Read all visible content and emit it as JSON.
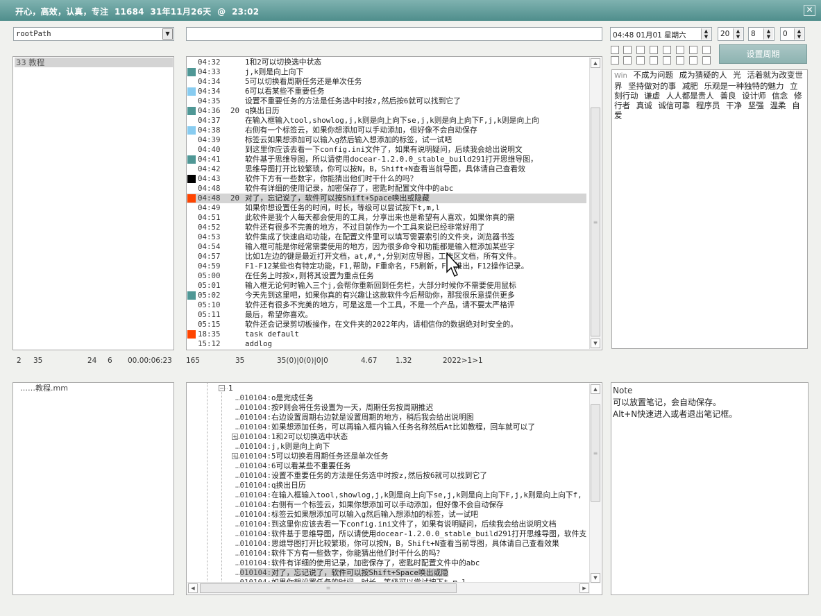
{
  "titlebar": {
    "title": "开心，高效，认真，专注  11684  31年11月26天  @  23:02",
    "close": "✕"
  },
  "top_controls": {
    "root_combo": "rootPath",
    "main_input": "",
    "datetime": "04:48 01月01 星期六",
    "spin1": "20",
    "spin2": "8",
    "spin3": "0",
    "period_button": "设置周期"
  },
  "left_list": {
    "items": [
      "33 教程"
    ]
  },
  "tasks": [
    {
      "time": "04:32",
      "pri": "",
      "color": "",
      "text": "1和2可以切换选中状态"
    },
    {
      "time": "04:33",
      "pri": "",
      "color": "#4f9795",
      "text": "j,k则是向上向下"
    },
    {
      "time": "04:34",
      "pri": "",
      "color": "",
      "text": "5可以切换看周期任务还是单次任务"
    },
    {
      "time": "04:34",
      "pri": "",
      "color": "#88ccf0",
      "text": "6可以看某些不重要任务"
    },
    {
      "time": "04:35",
      "pri": "",
      "color": "",
      "text": "设置不重要任务的方法是任务选中时按z,然后按6就可以找到它了"
    },
    {
      "time": "04:36",
      "pri": "20",
      "color": "#4f9795",
      "text": "q换出日历"
    },
    {
      "time": "04:37",
      "pri": "",
      "color": "",
      "text": "在输入框输入tool,showlog,j,k则是向上向下se,j,k则是向上向下F,j,k则是向上向"
    },
    {
      "time": "04:38",
      "pri": "",
      "color": "#88ccf0",
      "text": "右侧有一个标签云，如果你想添加可以手动添加，但好像不会自动保存"
    },
    {
      "time": "04:39",
      "pri": "",
      "color": "",
      "text": "标签云如果想添加可以输入g然后输入想添加的标签，试一试吧"
    },
    {
      "time": "04:40",
      "pri": "",
      "color": "",
      "text": "到这里你应该去看一下config.ini文件了，如果有说明疑问，后续我会给出说明文"
    },
    {
      "time": "04:41",
      "pri": "",
      "color": "#4f9795",
      "text": "软件基于思维导图，所以请使用docear-1.2.0.0_stable_build291打开思维导图，"
    },
    {
      "time": "04:42",
      "pri": "",
      "color": "",
      "text": "思维导图打开比较繁琐，你可以按N，B，Shift+N查看当前导图，具体请自己查看效"
    },
    {
      "time": "04:43",
      "pri": "",
      "color": "#000000",
      "text": "软件下方有一些数字，你能猜出他们时干什么的吗？"
    },
    {
      "time": "04:48",
      "pri": "",
      "color": "",
      "text": "软件有详细的使用记录，加密保存了，密匙时配置文件中的abc"
    },
    {
      "time": "04:48",
      "pri": "20",
      "color": "#ff4400",
      "text": "对了，忘记说了，软件可以按Shift+Space唤出或隐藏",
      "selected": true
    },
    {
      "time": "04:49",
      "pri": "",
      "color": "",
      "text": "如果你想设置任务的时间，时长，等级可以尝试按下t,m,l"
    },
    {
      "time": "04:51",
      "pri": "",
      "color": "",
      "text": "此软件是我个人每天都会使用的工具，分享出来也是希望有人喜欢，如果你真的需"
    },
    {
      "time": "04:52",
      "pri": "",
      "color": "",
      "text": "软件还有很多不完善的地方，不过目前作为一个工具来说已经非常好用了"
    },
    {
      "time": "04:53",
      "pri": "",
      "color": "",
      "text": "软件集成了快速启动功能，在配置文件里可以填写需要索引的文件夹，浏览器书签"
    },
    {
      "time": "04:54",
      "pri": "",
      "color": "",
      "text": "输入框可能是你经常需要使用的地方，因为很多命令和功能都是输入框添加某些字"
    },
    {
      "time": "04:57",
      "pri": "",
      "color": "",
      "text": "比如1左边的键是最近打开文档，at,#,*,分别对应导图，工作区文档，所有文件。"
    },
    {
      "time": "04:59",
      "pri": "",
      "color": "",
      "text": "F1-F12某些也有特定功能，F1,帮助，F重命名，F5刷新，F11推出，F12操作记录。"
    },
    {
      "time": "05:00",
      "pri": "",
      "color": "",
      "text": "在任务上时按x,则将其设置为重点任务"
    },
    {
      "time": "05:01",
      "pri": "",
      "color": "",
      "text": "输入框无论何时输入三个j,会帮你重新回到任务栏，大部分时候你不需要使用鼠标"
    },
    {
      "time": "05:02",
      "pri": "",
      "color": "#4f9795",
      "text": "今天先到这里吧，如果你真的有兴趣让这款软件今后帮助你，那我很乐意提供更多"
    },
    {
      "time": "05:10",
      "pri": "",
      "color": "",
      "text": "软件还有很多不完美的地方，可是这是一个工具，不是一个产品，请不要太严格评"
    },
    {
      "time": "05:11",
      "pri": "",
      "color": "",
      "text": "最后，希望你喜欢。"
    },
    {
      "time": "05:15",
      "pri": "",
      "color": "",
      "text": "软件还会记录剪切板操作，在文件夹的2022年内，请相信你的数据绝对时安全的。"
    },
    {
      "time": "18:35",
      "pri": "",
      "color": "#ff4400",
      "text": "task default"
    },
    {
      "time": "15:12",
      "pri": "",
      "color": "",
      "text": "addlog"
    }
  ],
  "status_bar": [
    "2",
    "35",
    "24",
    "6",
    "00.00:06:23",
    "165",
    "35",
    "35(0)|0(0)|0|0",
    "4.67",
    "1.32",
    "2022>1>1"
  ],
  "tag_cloud": [
    "Win",
    "不成为问题",
    "成为猜疑的人",
    "光",
    "活着就为改变世界",
    "坚持做对的事",
    "减肥",
    "乐观是一种独特的魅力",
    "立刻行动",
    "谦虚",
    "人人都是贵人",
    "善良",
    "设计师",
    "信念",
    "修行者",
    "真诚",
    "诚信可靠",
    "程序员",
    "干净",
    "坚强",
    "温柔",
    "自爱"
  ],
  "mindmap_list": {
    "items": [
      "……教程.mm"
    ]
  },
  "tree": {
    "root_label": "1",
    "prefix": "010104:",
    "rows": [
      {
        "text": "o是完成任务",
        "exp": false
      },
      {
        "text": "按P则会将任务设置为一天，周期任务按周期推迟",
        "exp": false
      },
      {
        "text": "右边设置周期右边就是设置周期的地方，稍后我会给出说明图",
        "exp": false
      },
      {
        "text": "如果想添加任务，可以再输入框内输入任务名称然后At比如教程，回车就可以了",
        "exp": false
      },
      {
        "text": "1和2可以切换选中状态",
        "exp": true
      },
      {
        "text": "j,k则是向上向下",
        "exp": false
      },
      {
        "text": "5可以切换看周期任务还是单次任务",
        "exp": true
      },
      {
        "text": "6可以看某些不重要任务",
        "exp": false
      },
      {
        "text": "设置不重要任务的方法是任务选中时按z,然后按6就可以找到它了",
        "exp": false
      },
      {
        "text": "q换出日历",
        "exp": false
      },
      {
        "text": "在输入框输入tool,showlog,j,k则是向上向下se,j,k则是向上向下F,j,k则是向上向下f,",
        "exp": false
      },
      {
        "text": "右侧有一个标签云，如果你想添加可以手动添加，但好像不会自动保存",
        "exp": false
      },
      {
        "text": "标签云如果想添加可以输入g然后输入想添加的标签，试一试吧",
        "exp": false
      },
      {
        "text": "到这里你应该去看一下config.ini文件了，如果有说明疑问，后续我会给出说明文档",
        "exp": false
      },
      {
        "text": "软件基于思维导图，所以请使用docear-1.2.0.0_stable_build291打开思维导图，软件支",
        "exp": false
      },
      {
        "text": "思维导图打开比较繁琐，你可以按N，B，Shift+N查看当前导图，具体请自己查看效果",
        "exp": false
      },
      {
        "text": "软件下方有一些数字，你能猜出他们时干什么的吗？",
        "exp": false
      },
      {
        "text": "软件有详细的使用记录，加密保存了，密匙时配置文件中的abc",
        "exp": false
      },
      {
        "text": "对了，忘记说了，软件可以按Shift+Space唤出或隐",
        "exp": false,
        "selected": true
      },
      {
        "text": "如果你想设置任务的时间，时长，等级可以尝试按下t,m,l",
        "exp": false
      }
    ]
  },
  "note": {
    "title": "Note",
    "lines": [
      "可以放置笔记，会自动保存。",
      "Alt+N快速进入或者退出笔记框。"
    ]
  }
}
